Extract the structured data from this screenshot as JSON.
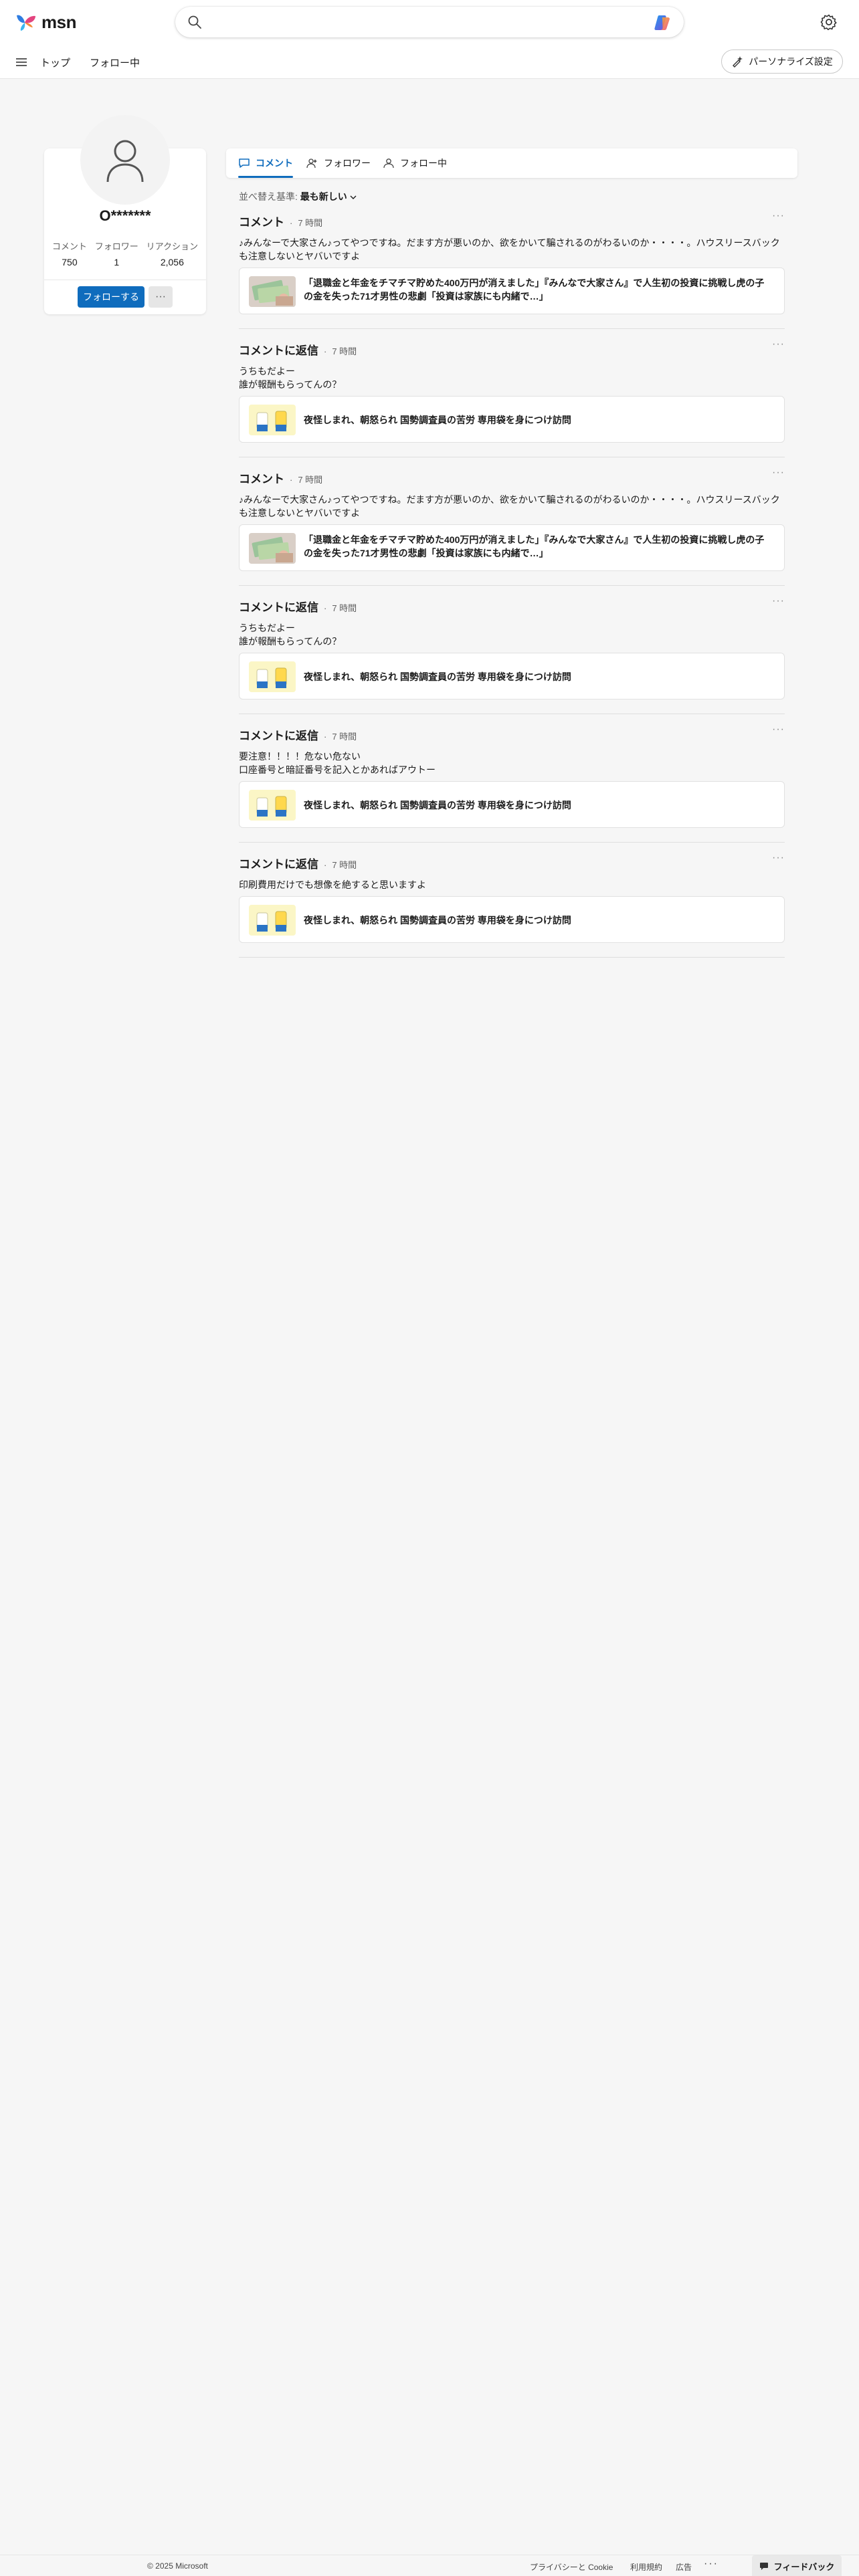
{
  "header": {
    "logo_text": "msn",
    "search_placeholder": ""
  },
  "subnav": {
    "links": [
      "トップ",
      "フォロー中"
    ],
    "personalize_label": "パーソナライズ設定"
  },
  "profile": {
    "name": "O*******",
    "stats": [
      {
        "label": "コメント",
        "value": "750"
      },
      {
        "label": "フォロワー",
        "value": "1"
      },
      {
        "label": "リアクション",
        "value": "2,056"
      }
    ],
    "follow_label": "フォローする",
    "more_label": "···"
  },
  "tabs": [
    {
      "label": "コメント",
      "active": true
    },
    {
      "label": "フォロワー",
      "active": false
    },
    {
      "label": "フォロー中",
      "active": false
    }
  ],
  "sort": {
    "label": "並べ替え基準:",
    "value": "最も新しい"
  },
  "feed": [
    {
      "type": "コメント",
      "time": "7 時間",
      "lines": [
        "♪みんなーで大家さん♪ってやつですね。だます方が悪いのか、欲をかいて騙されるのがわるいのか・・・・。ハウスリースバック",
        "も注意しないとヤバいですよ"
      ],
      "article": "「退職金と年金をチマチマ貯めた400万円が消えました」『みんなで大家さん』で人生初の投資に挑戦し虎の子の金を失った71才男性の悲劇「投資は家族にも内緒で…」",
      "thumb": "money"
    },
    {
      "type": "コメントに返信",
      "time": "7 時間",
      "lines": [
        "うちもだよー",
        "誰が報酬もらってんの？"
      ],
      "article": "夜怪しまれ、朝怒られ 国勢調査員の苦労 専用袋を身につけ訪問",
      "thumb": "bags"
    },
    {
      "type": "コメント",
      "time": "7 時間",
      "lines": [
        "♪みんなーで大家さん♪ってやつですね。だます方が悪いのか、欲をかいて騙されるのがわるいのか・・・・。ハウスリースバック",
        "も注意しないとヤバいですよ"
      ],
      "article": "「退職金と年金をチマチマ貯めた400万円が消えました」『みんなで大家さん』で人生初の投資に挑戦し虎の子の金を失った71才男性の悲劇「投資は家族にも内緒で…」",
      "thumb": "money"
    },
    {
      "type": "コメントに返信",
      "time": "7 時間",
      "lines": [
        "うちもだよー",
        "誰が報酬もらってんの？"
      ],
      "article": "夜怪しまれ、朝怒られ 国勢調査員の苦労 専用袋を身につけ訪問",
      "thumb": "bags"
    },
    {
      "type": "コメントに返信",
      "time": "7 時間",
      "lines": [
        "要注意！！！！危ない危ない",
        "口座番号と暗証番号を記入とかあればアウトー"
      ],
      "article": "夜怪しまれ、朝怒られ 国勢調査員の苦労 専用袋を身につけ訪問",
      "thumb": "bags"
    },
    {
      "type": "コメントに返信",
      "time": "7 時間",
      "lines": [
        "印刷費用だけでも想像を絶すると思いますよ"
      ],
      "article": "夜怪しまれ、朝怒られ 国勢調査員の苦労 専用袋を身につけ訪問",
      "thumb": "bags"
    }
  ],
  "footer": {
    "copyright": "© 2025 Microsoft",
    "links": [
      "プライバシーと Cookie",
      "利用規約",
      "広告"
    ],
    "more": "···",
    "feedback_label": "フィードバック"
  },
  "colors": {
    "accent": "#0f6cbd",
    "background": "#f6f6f6",
    "card": "#ffffff"
  }
}
